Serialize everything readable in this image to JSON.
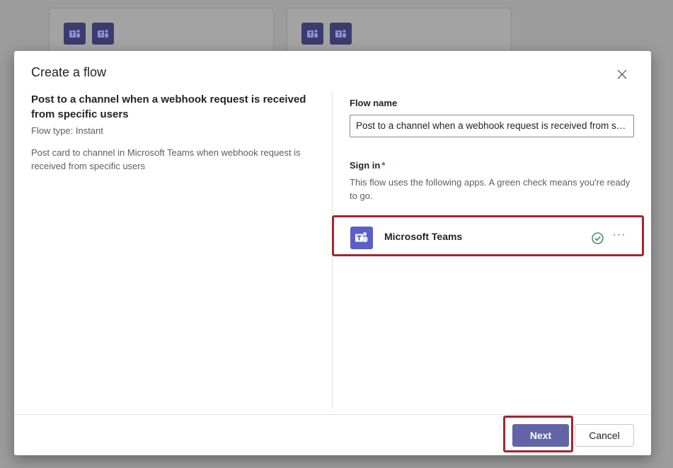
{
  "background": {
    "cards": [
      {
        "icons": [
          "teams-icon",
          "teams-icon"
        ]
      },
      {
        "icons": [
          "teams-icon",
          "teams-icon"
        ]
      }
    ]
  },
  "dialog": {
    "title": "Create a flow",
    "close_icon": "close-icon",
    "template": {
      "title": "Post to a channel when a webhook request is received from specific users",
      "flow_type": "Flow type: Instant",
      "description": "Post card to channel in Microsoft Teams when webhook request is received from specific users"
    },
    "flow_name": {
      "label": "Flow name",
      "value": "Post to a channel when a webhook request is received from specific users"
    },
    "sign_in": {
      "label": "Sign in",
      "required_marker": "*",
      "description": "This flow uses the following apps. A green check means you're ready to go.",
      "apps": [
        {
          "name": "Microsoft Teams",
          "icon": "teams-icon",
          "status": "connected",
          "more": "···"
        }
      ]
    },
    "footer": {
      "next_label": "Next",
      "cancel_label": "Cancel"
    }
  },
  "colors": {
    "accent": "#6264a7",
    "teams_icon": "#5b5fc7",
    "success": "#237b4b",
    "highlight": "#a4262c",
    "required": "#c4314b"
  }
}
